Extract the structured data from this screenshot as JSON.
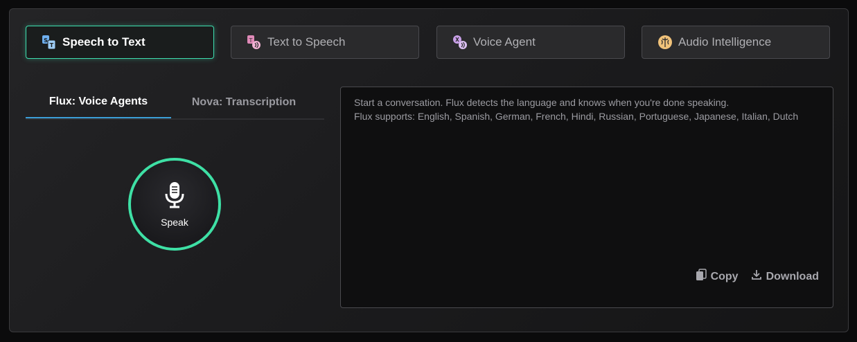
{
  "mode_tabs": [
    {
      "label": "Speech to Text",
      "icon": "speech-to-text-icon",
      "active": true
    },
    {
      "label": "Text to Speech",
      "icon": "text-to-speech-icon",
      "active": false
    },
    {
      "label": "Voice Agent",
      "icon": "voice-agent-icon",
      "active": false
    },
    {
      "label": "Audio Intelligence",
      "icon": "brain-icon",
      "active": false
    }
  ],
  "sub_tabs": [
    {
      "label": "Flux: Voice Agents",
      "active": true
    },
    {
      "label": "Nova: Transcription",
      "active": false
    }
  ],
  "speak": {
    "label": "Speak",
    "icon": "microphone-icon"
  },
  "transcript": {
    "line1": "Start a conversation. Flux detects the language and knows when you're done speaking.",
    "line2": "Flux supports: English, Spanish, German, French, Hindi, Russian, Portuguese, Japanese, Italian, Dutch"
  },
  "actions": {
    "copy_label": "Copy",
    "download_label": "Download"
  },
  "colors": {
    "accent_green": "#3ee0a5",
    "accent_blue": "#3b9fd8",
    "tts_icon": "#e08ab8",
    "voice_agent_icon": "#c9a0e8",
    "audio_intel_icon": "#f0c27a",
    "stt_icon": "#6fb0f0"
  }
}
